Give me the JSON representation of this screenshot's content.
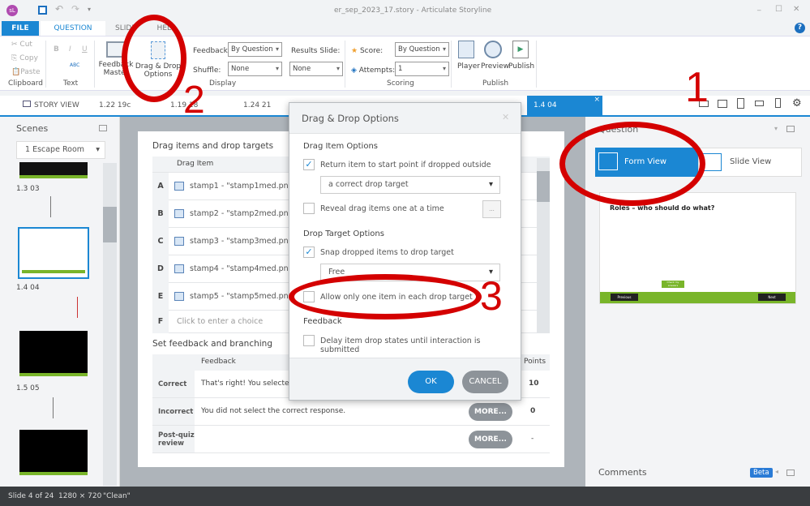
{
  "window": {
    "title": "er_sep_2023_17.story  -  Articulate Storyline",
    "app_icon": "sL",
    "minimize": "_",
    "maximize": "☐",
    "close": "✕",
    "help": "?"
  },
  "menu_tabs": [
    {
      "label": "FILE"
    },
    {
      "label": "QUESTION"
    },
    {
      "label": "SLIDE"
    },
    {
      "label": "HELP"
    }
  ],
  "ribbon": {
    "clipboard": {
      "cut": "Cut",
      "copy": "Copy",
      "paste": "Paste",
      "label": "Clipboard"
    },
    "text": {
      "bold": "B",
      "italic": "I",
      "underline": "U",
      "spell": "ABC",
      "label": "Text"
    },
    "display": {
      "feedback_master": "Feedback Master",
      "drag_drop": "Drag & Drop Options",
      "feedback_label": "Feedback:",
      "feedback_value": "By Question",
      "shuffle_label": "Shuffle:",
      "shuffle_value": "None",
      "results_label": "Results Slide:",
      "results_value": "None",
      "label": "Display"
    },
    "scoring": {
      "score_label": "Score:",
      "score_value": "By Question",
      "attempts_label": "Attempts:",
      "attempts_value": "1",
      "label": "Scoring"
    },
    "publish": {
      "player": "Player",
      "preview": "Preview",
      "publish": "Publish",
      "label": "Publish"
    }
  },
  "doc_tabs": [
    {
      "label": "STORY VIEW"
    },
    {
      "label": "1.22 19c"
    },
    {
      "label": "1.19 18"
    },
    {
      "label": "1.24 21"
    },
    {
      "label": "1.4 04",
      "active": true
    }
  ],
  "tab_close": "×",
  "scenes": {
    "title": "Scenes",
    "scene_select": "1 Escape Room",
    "slides": [
      {
        "label": "1.3 03"
      },
      {
        "label": "1.4 04",
        "selected": true
      },
      {
        "label": "1.5 05"
      }
    ]
  },
  "form": {
    "drag_title": "Drag items and drop targets",
    "drag_col": "Drag Item",
    "items": [
      {
        "letter": "A",
        "text": "stamp1 - \"stamp1med.png\""
      },
      {
        "letter": "B",
        "text": "stamp2 - \"stamp2med.png\""
      },
      {
        "letter": "C",
        "text": "stamp3 - \"stamp3med.png\""
      },
      {
        "letter": "D",
        "text": "stamp4 - \"stamp4med.png\""
      },
      {
        "letter": "E",
        "text": "stamp5 - \"stamp5med.png\""
      },
      {
        "letter": "F",
        "text": "Click to enter a choice"
      }
    ],
    "feedback_title": "Set feedback and branching",
    "fb_col": "Feedback",
    "points_col": "Points",
    "feedback_rows": [
      {
        "label": "Correct",
        "text": "That's right!  You selected the correct response.",
        "more": "MORE...",
        "points": "10"
      },
      {
        "label": "Incorrect",
        "text": "You did not select the correct response.",
        "more": "MORE...",
        "points": "0"
      },
      {
        "label": "Post-quiz review",
        "text": "",
        "more": "MORE...",
        "points": "-"
      }
    ]
  },
  "dialog": {
    "title": "Drag & Drop Options",
    "close": "✕",
    "drag_section": "Drag Item Options",
    "return_label": "Return item to start point if dropped outside",
    "return_checked": true,
    "return_select": "a correct drop target",
    "reveal_label": "Reveal drag items one at a time",
    "reveal_checked": false,
    "reveal_btn": "...",
    "target_section": "Drop Target Options",
    "snap_label": "Snap dropped items to drop target",
    "snap_checked": true,
    "snap_select": "Free",
    "allow_label": "Allow only one item in each drop target",
    "allow_checked": false,
    "feedback_section": "Feedback",
    "delay_label": "Delay item drop states until interaction is submitted",
    "delay_checked": false,
    "ok": "OK",
    "cancel": "CANCEL"
  },
  "question_panel": {
    "title": "Question",
    "form_view": "Form View",
    "slide_view": "Slide View",
    "preview_title": "Roles – who should do what?",
    "preview_prev": "Previous",
    "preview_next": "Next",
    "preview_check": "Check my answers"
  },
  "comments": {
    "title": "Comments",
    "badge": "Beta"
  },
  "status": {
    "slide": "Slide 4 of 24",
    "size": "1280 × 720",
    "theme": "\"Clean\""
  },
  "annotations": {
    "one": "1",
    "two": "2",
    "three": "3"
  },
  "colors": {
    "accent": "#1b87d3",
    "annotation": "#d40000"
  }
}
